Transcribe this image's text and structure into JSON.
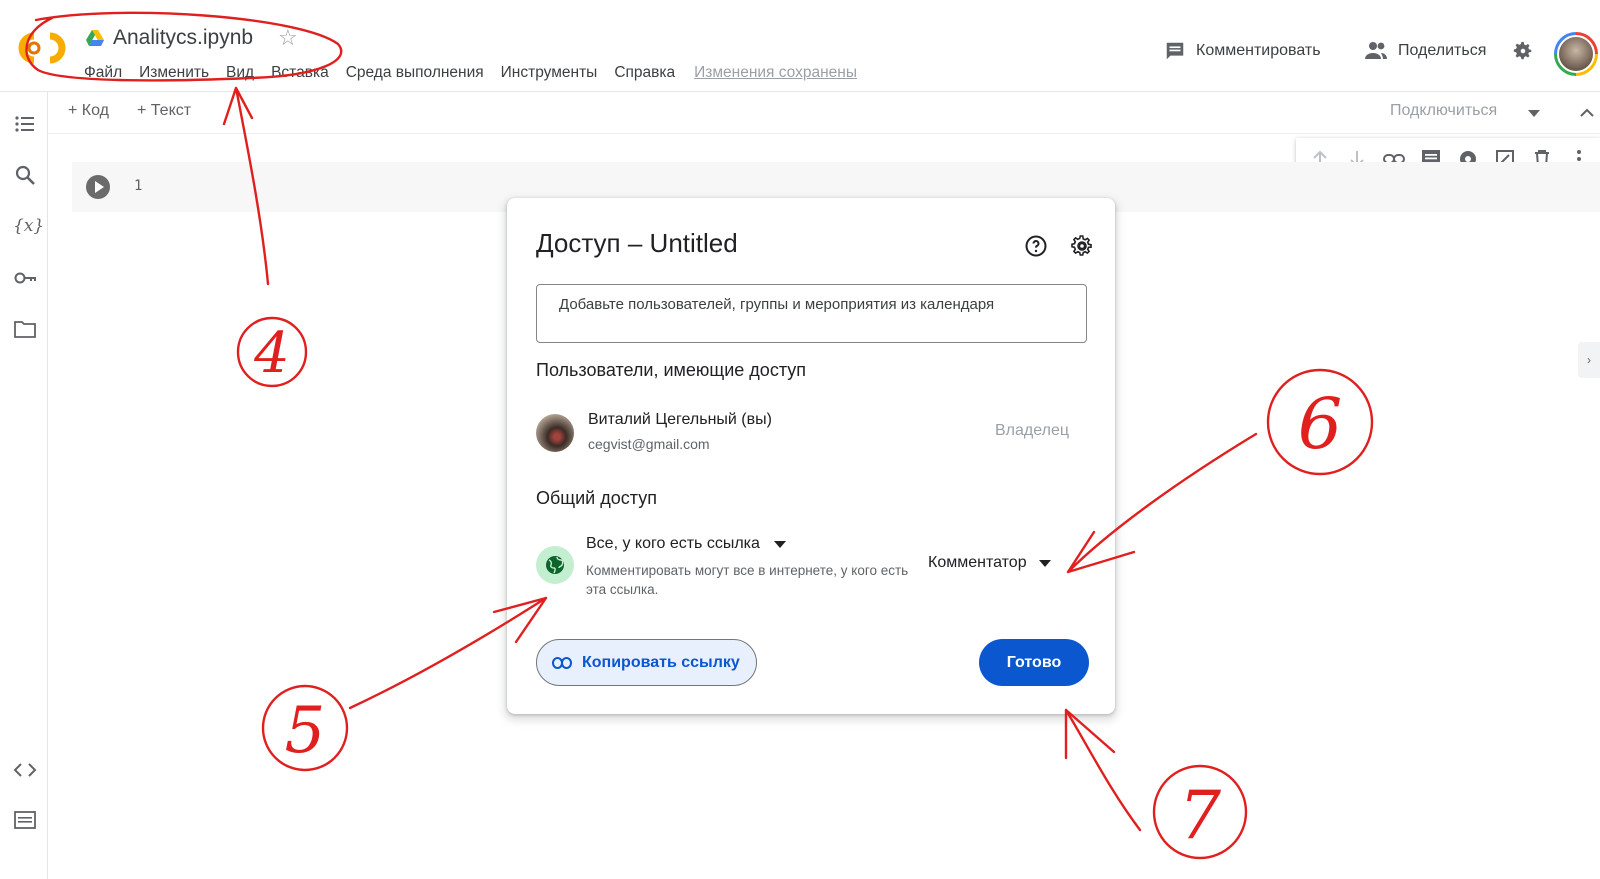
{
  "header": {
    "doc_title": "Analitycs.ipynb",
    "menu": [
      "Файл",
      "Изменить",
      "Вид",
      "Вставка",
      "Среда выполнения",
      "Инструменты",
      "Справка"
    ],
    "saved_status": "Изменения сохранены",
    "comment_label": "Комментировать",
    "share_label": "Поделиться"
  },
  "toolbar": {
    "add_code": "+ Код",
    "add_text": "+ Текст",
    "connect": "Подключиться"
  },
  "cell": {
    "line_number": "1"
  },
  "dialog": {
    "title": "Доступ – Untitled",
    "add_people_placeholder": "Добавьте пользователей, группы и мероприятия из календаря",
    "people_section": "Пользователи, имеющие доступ",
    "user_name": "Виталий Цегельный (вы)",
    "user_email": "cegvist@gmail.com",
    "user_role": "Владелец",
    "general_access_section": "Общий доступ",
    "link_scope": "Все, у кого есть ссылка",
    "link_description": "Комментировать могут все в интернете, у кого есть эта ссылка.",
    "link_role": "Комментатор",
    "copy_link": "Копировать ссылку",
    "done": "Готово"
  },
  "annotations": {
    "label_4": "4",
    "label_5": "5",
    "label_6": "6",
    "label_7": "7",
    "color": "#e0201e"
  },
  "colors": {
    "primary": "#0b57d0",
    "globe_bg": "#c4eed0"
  }
}
